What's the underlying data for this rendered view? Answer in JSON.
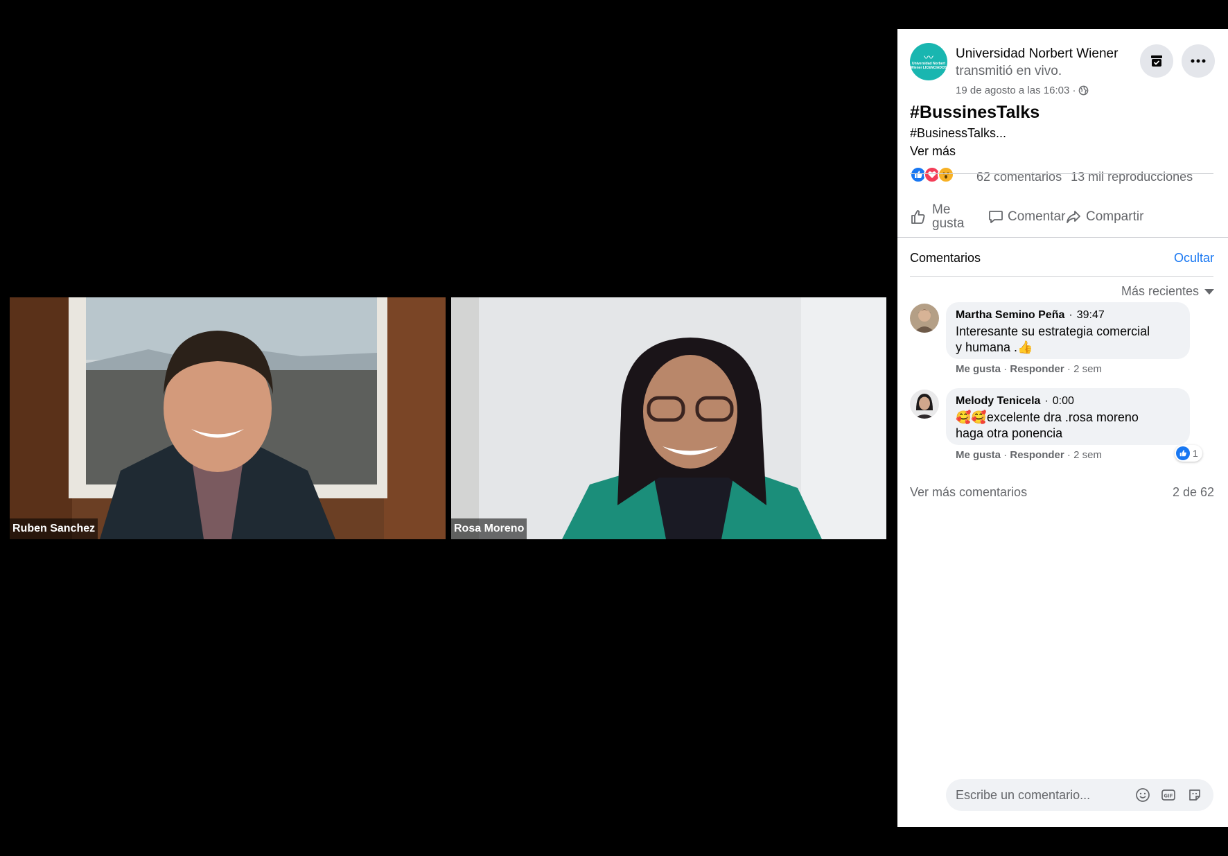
{
  "participants": [
    {
      "name": "Ruben Sanchez"
    },
    {
      "name": "Rosa Moreno"
    }
  ],
  "post": {
    "page_name": "Universidad Norbert Wiener",
    "logo_text": "Universidad Norbert Wiener LICENCIADOS",
    "live_text": "transmitió en vivo.",
    "date": "19 de agosto a las 16:03 ·",
    "title": "#BussinesTalks",
    "body": "#BusinessTalks...",
    "see_more": "Ver más",
    "comments_count": "62 comentarios",
    "views": "13 mil reproducciones",
    "reaction_icons": [
      "like-icon",
      "love-icon",
      "wow-icon"
    ]
  },
  "actions": {
    "like_line1": "Me",
    "like_line2": "gusta",
    "comment": "Comentar",
    "share": "Compartir"
  },
  "comments_section": {
    "heading": "Comentarios",
    "hide": "Ocultar",
    "sort": "Más recientes",
    "items": [
      {
        "author": "Martha Semino Peña",
        "time": "39:47",
        "text_line1": "Interesante su estrategia comercial",
        "text_line2": "y humana .👍",
        "like": "Me gusta",
        "reply": "Responder",
        "age": "2 sem"
      },
      {
        "author": "Melody Tenicela",
        "time": "0:00",
        "text_line1": "🥰🥰excelente dra .rosa moreno",
        "text_line2": "haga otra ponencia",
        "like": "Me gusta",
        "reply": "Responder",
        "age": "2 sem",
        "likes": "1"
      }
    ],
    "more": "Ver más comentarios",
    "count": "2 de 62"
  },
  "composer": {
    "placeholder": "Escribe un comentario..."
  },
  "colors": {
    "accent": "#1877f2",
    "brand": "#19b6b0",
    "muted": "#65676b",
    "bubble": "#f0f2f5"
  }
}
